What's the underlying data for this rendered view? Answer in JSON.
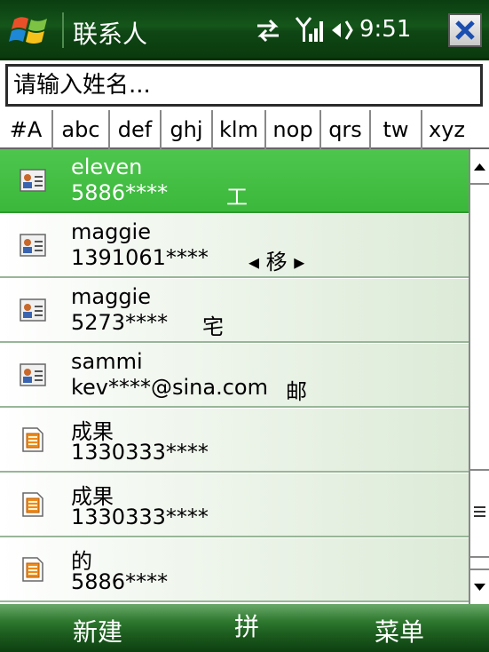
{
  "titlebar": {
    "title": "联系人",
    "time": "9:51",
    "icons": [
      "windows-start-icon",
      "sync-icon",
      "signal-icon",
      "volume-icon",
      "close-icon"
    ]
  },
  "search": {
    "placeholder": "请输入姓名..."
  },
  "alpha_tabs": [
    {
      "label": "#A"
    },
    {
      "label": "abc"
    },
    {
      "label": "def"
    },
    {
      "label": "ghj"
    },
    {
      "label": "klm"
    },
    {
      "label": "nop"
    },
    {
      "label": "qrs"
    },
    {
      "label": "tw"
    },
    {
      "label": "xyz"
    }
  ],
  "contacts": [
    {
      "name": "eleven",
      "value": "5886****",
      "type": "工",
      "icon": "contact-card-icon",
      "selected": true
    },
    {
      "name": "maggie",
      "value": "1391061****",
      "type": "◂ 移 ▸",
      "icon": "contact-card-icon",
      "selected": false
    },
    {
      "name": "maggie",
      "value": "5273****",
      "type": "宅",
      "icon": "contact-card-icon",
      "selected": false
    },
    {
      "name": " sammi",
      "value": "kev****@sina.com",
      "type": "邮",
      "icon": "contact-card-icon",
      "selected": false
    },
    {
      "name": "成果",
      "value": "1330333****",
      "type": "",
      "icon": "sim-card-icon",
      "selected": false
    },
    {
      "name": "成果",
      "value": "1330333****",
      "type": "",
      "icon": "sim-card-icon",
      "selected": false
    },
    {
      "name": "的",
      "value": "5886****",
      "type": "",
      "icon": "sim-card-icon",
      "selected": false
    }
  ],
  "softkeys": {
    "left": "新建",
    "center": "拼",
    "right": "菜单"
  },
  "colors": {
    "selected_row": "#3cba3c",
    "title_bar": "#15561b",
    "softkey_bar": "#1e5f20"
  }
}
